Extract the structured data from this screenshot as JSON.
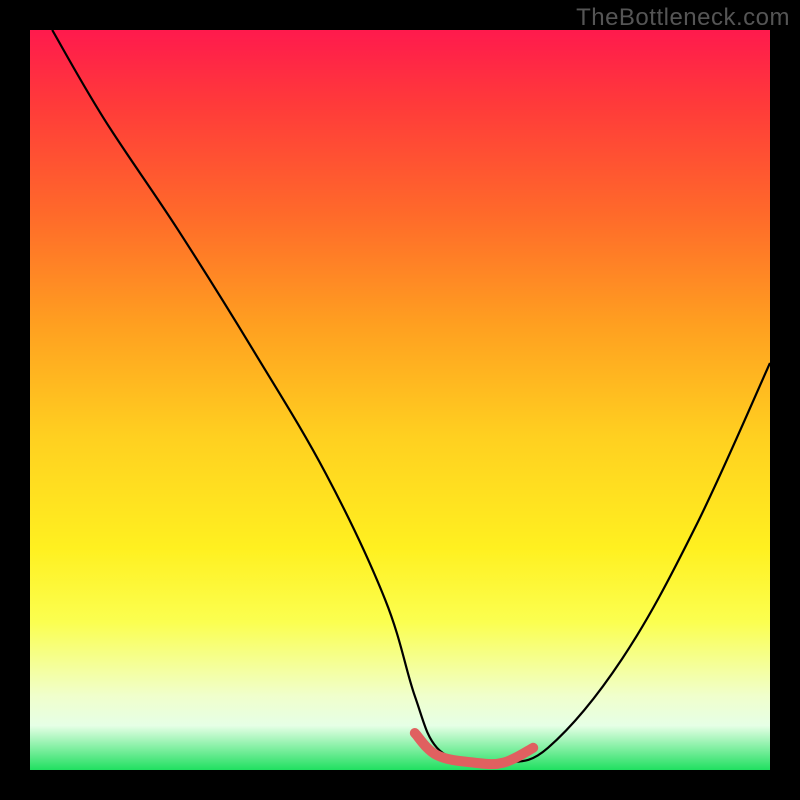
{
  "watermark": "TheBottleneck.com",
  "chart_data": {
    "type": "line",
    "title": "",
    "xlabel": "",
    "ylabel": "",
    "xlim": [
      0,
      100
    ],
    "ylim": [
      0,
      100
    ],
    "gradient_stops": [
      {
        "pos": 0,
        "color": "#ff1a4d"
      },
      {
        "pos": 10,
        "color": "#ff3a3a"
      },
      {
        "pos": 25,
        "color": "#ff6a2a"
      },
      {
        "pos": 40,
        "color": "#ffa020"
      },
      {
        "pos": 55,
        "color": "#ffd020"
      },
      {
        "pos": 70,
        "color": "#fff020"
      },
      {
        "pos": 80,
        "color": "#fbff50"
      },
      {
        "pos": 90,
        "color": "#f0ffcc"
      },
      {
        "pos": 94,
        "color": "#e6ffe6"
      },
      {
        "pos": 100,
        "color": "#20e060"
      }
    ],
    "series": [
      {
        "name": "bottleneck-curve",
        "color": "#000000",
        "x": [
          3,
          10,
          20,
          30,
          40,
          48,
          52,
          55,
          60,
          64,
          70,
          80,
          90,
          100
        ],
        "y": [
          100,
          88,
          73,
          57,
          40,
          23,
          10,
          3,
          1,
          1,
          3,
          15,
          33,
          55
        ]
      },
      {
        "name": "valley-highlight",
        "color": "#e06060",
        "x": [
          52,
          55,
          60,
          64,
          68
        ],
        "y": [
          5,
          2,
          1,
          1,
          3
        ]
      }
    ]
  }
}
